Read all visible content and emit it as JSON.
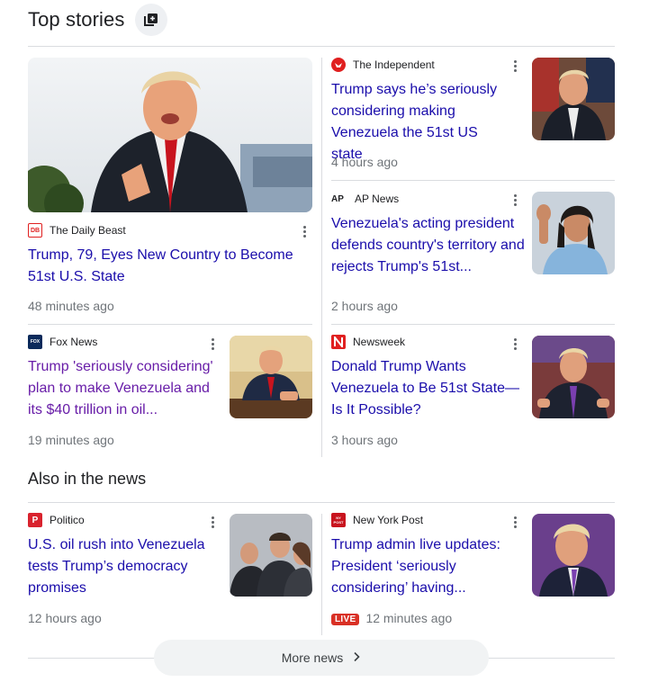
{
  "section_title": "Top stories",
  "also_title": "Also in the news",
  "more_news": "More news",
  "stories": [
    {
      "source": "The Daily Beast",
      "title": "Trump, 79, Eyes New Country to Become 51st U.S. State",
      "time": "48 minutes ago"
    },
    {
      "source": "The Independent",
      "title": "Trump says he’s seriously considering making Venezuela the 51st US state",
      "time": "4 hours ago"
    },
    {
      "source": "AP News",
      "title": "Venezuela's acting president defends country's territory and rejects Trump's 51st...",
      "time": "2 hours ago"
    },
    {
      "source": "Fox News",
      "title": "Trump 'seriously considering' plan to make Venezuela and its $40 trillion in oil...",
      "time": "19 minutes ago"
    },
    {
      "source": "Newsweek",
      "title": "Donald Trump Wants Venezuela to Be 51st State—Is It Possible?",
      "time": "3 hours ago"
    },
    {
      "source": "Politico",
      "title": "U.S. oil rush into Venezuela tests Trump’s democracy promises",
      "time": "12 hours ago"
    },
    {
      "source": "New York Post",
      "title": "Trump admin live updates: President ‘seriously considering’ having...",
      "time": "12 minutes ago",
      "badge": "LIVE"
    }
  ],
  "logo_text": {
    "daily_beast": "DB",
    "ap": "AP",
    "fox": "FOX",
    "politico": "P",
    "nypost": "NY POST"
  },
  "colors": {
    "link": "#1a0dab",
    "visited": "#681da8",
    "live": "#d93025"
  }
}
